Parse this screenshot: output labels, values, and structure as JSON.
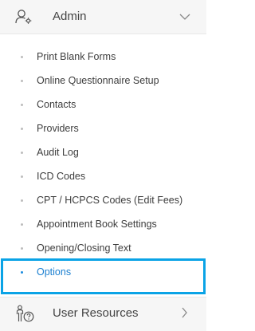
{
  "header": {
    "title": "Admin",
    "icon": "user-gear-icon",
    "chevron": "chevron-down-icon"
  },
  "menu": {
    "items": [
      {
        "label": "Print Blank Forms"
      },
      {
        "label": "Online Questionnaire Setup"
      },
      {
        "label": "Contacts"
      },
      {
        "label": "Providers"
      },
      {
        "label": "Audit Log"
      },
      {
        "label": "ICD Codes"
      },
      {
        "label": "CPT / HCPCS Codes (Edit Fees)"
      },
      {
        "label": "Appointment Book Settings"
      },
      {
        "label": "Opening/Closing Text"
      },
      {
        "label": "Options"
      }
    ],
    "active_index": 9
  },
  "footer": {
    "title": "User Resources",
    "icon": "person-help-icon",
    "chevron": "chevron-right-icon"
  },
  "colors": {
    "accent": "#1a7fd0",
    "highlight_border": "#0aa3e6",
    "header_bg": "#f6f6f6"
  }
}
